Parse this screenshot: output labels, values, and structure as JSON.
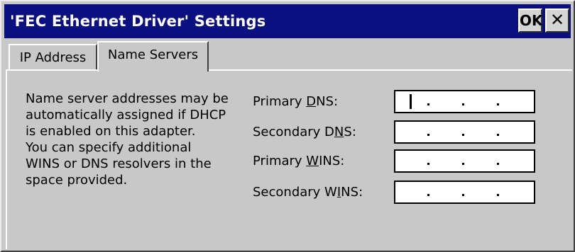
{
  "window": {
    "title": "'FEC Ethernet Driver' Settings",
    "ok_label": "OK",
    "close_label": "✕"
  },
  "tabs": [
    {
      "label": "IP Address",
      "selected": false
    },
    {
      "label": "Name Servers",
      "selected": true
    }
  ],
  "name_servers": {
    "description": "Name server addresses may be\nautomatically assigned if DHCP\nis enabled on this adapter.\nYou can specify additional\nWINS or DNS resolvers in the\nspace provided.",
    "fields": [
      {
        "label_pre": "Primary ",
        "label_key": "D",
        "label_post": "NS:",
        "value": "   .   .   .",
        "focused": true
      },
      {
        "label_pre": "Secondary D",
        "label_key": "N",
        "label_post": "S:",
        "value": "   .   .   .",
        "focused": false
      },
      {
        "label_pre": "Primary ",
        "label_key": "W",
        "label_post": "INS:",
        "value": "   .   .   .",
        "focused": false
      },
      {
        "label_pre": "Secondary W",
        "label_key": "I",
        "label_post": "NS:",
        "value": "   .   .   .",
        "focused": false
      }
    ]
  },
  "colors": {
    "titlebar": "#0a1080",
    "window_bg": "#c8c8c8",
    "field_bg": "#ffffff"
  }
}
